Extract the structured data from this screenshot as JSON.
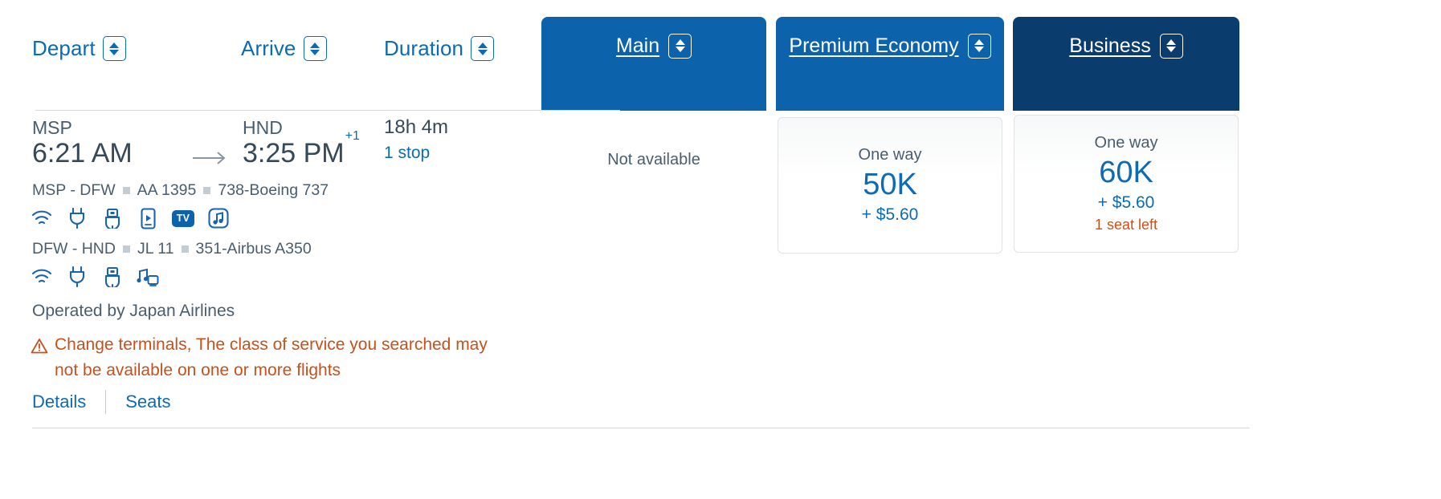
{
  "header": {
    "sorts": [
      {
        "label": "Depart",
        "name": "depart",
        "icon": "sort-updown-icon"
      },
      {
        "label": "Arrive",
        "name": "arrive",
        "icon": "sort-updown-icon"
      },
      {
        "label": "Duration",
        "name": "duration",
        "icon": "sort-updown-icon"
      }
    ],
    "cabins": [
      {
        "label": "Main",
        "color": "#0c63ab"
      },
      {
        "label": "Premium Economy",
        "color": "#0c63ab"
      },
      {
        "label": "Business",
        "color": "#0a3c6e"
      }
    ]
  },
  "flight": {
    "depart_code": "MSP",
    "depart_time": "6:21 AM",
    "arrive_code": "HND",
    "arrive_time": "3:25 PM",
    "arrive_day_offset": "+1",
    "duration": "18h 4m",
    "stops": "1 stop",
    "arrow_icon": "arrow-right-icon",
    "segments": [
      {
        "route": "MSP - DFW",
        "flight_number": "AA 1395",
        "aircraft": "738-Boeing 737",
        "amenities": [
          "wifi-icon",
          "power-outlet-icon",
          "usb-port-icon",
          "device-streaming-icon",
          "tv-icon",
          "music-icon"
        ]
      },
      {
        "route": "DFW - HND",
        "flight_number": "JL 11",
        "aircraft": "351-Airbus A350",
        "amenities": [
          "wifi-icon",
          "power-outlet-icon",
          "usb-port-icon",
          "music-video-icon"
        ]
      }
    ],
    "operated_by": "Operated by Japan Airlines",
    "warning": {
      "icon": "warning-triangle-icon",
      "text": "Change terminals, The class of service you searched may not be available on one or more flights",
      "color": "#c8511b"
    },
    "links": [
      {
        "label": "Details"
      },
      {
        "label": "Seats"
      }
    ]
  },
  "fares": [
    {
      "cabin": "Main",
      "available": false,
      "unavailable_text": "Not available"
    },
    {
      "cabin": "Premium Economy",
      "available": true,
      "trip_type": "One way",
      "points": "50K",
      "taxes": "+ $5.60",
      "seats_left": ""
    },
    {
      "cabin": "Business",
      "available": true,
      "trip_type": "One way",
      "points": "60K",
      "taxes": "+ $5.60",
      "seats_left": "1 seat left"
    }
  ],
  "colors": {
    "link_blue": "#0c6bb4",
    "tab_blue": "#0c63ab",
    "tab_navy": "#0a3c6e",
    "warn_orange": "#c8511b",
    "text_slate": "#36495a"
  }
}
